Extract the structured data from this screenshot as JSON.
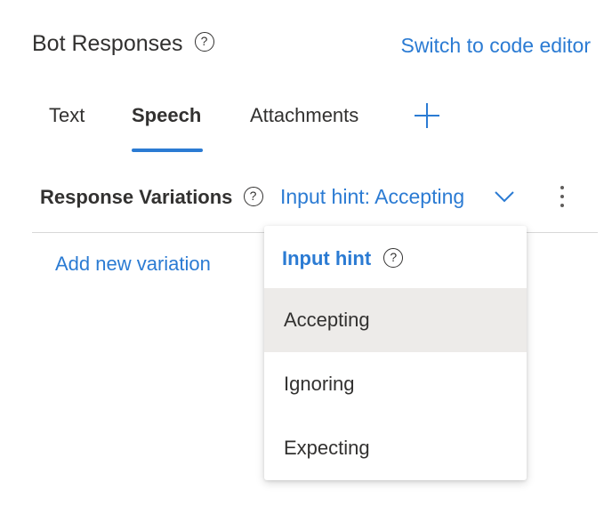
{
  "header": {
    "title": "Bot Responses",
    "help_glyph": "?",
    "code_editor_link": "Switch to code editor"
  },
  "tabs": {
    "items": [
      {
        "label": "Text"
      },
      {
        "label": "Speech"
      },
      {
        "label": "Attachments"
      }
    ],
    "active": "Speech",
    "add_icon": "plus-icon"
  },
  "variations": {
    "label": "Response Variations",
    "help_glyph": "?",
    "input_hint_label": "Input hint: Accepting",
    "chevron_icon": "chevron-down-icon",
    "more_icon": "more-vertical-icon",
    "add_variation": "Add new variation"
  },
  "dropdown": {
    "header": "Input hint",
    "help_glyph": "?",
    "options": [
      {
        "label": "Accepting"
      },
      {
        "label": "Ignoring"
      },
      {
        "label": "Expecting"
      }
    ],
    "selected": "Accepting"
  },
  "colors": {
    "accent": "#2b7bd3",
    "text": "#323130",
    "selected_bg": "#edebe9",
    "divider": "#d8d8d8"
  }
}
